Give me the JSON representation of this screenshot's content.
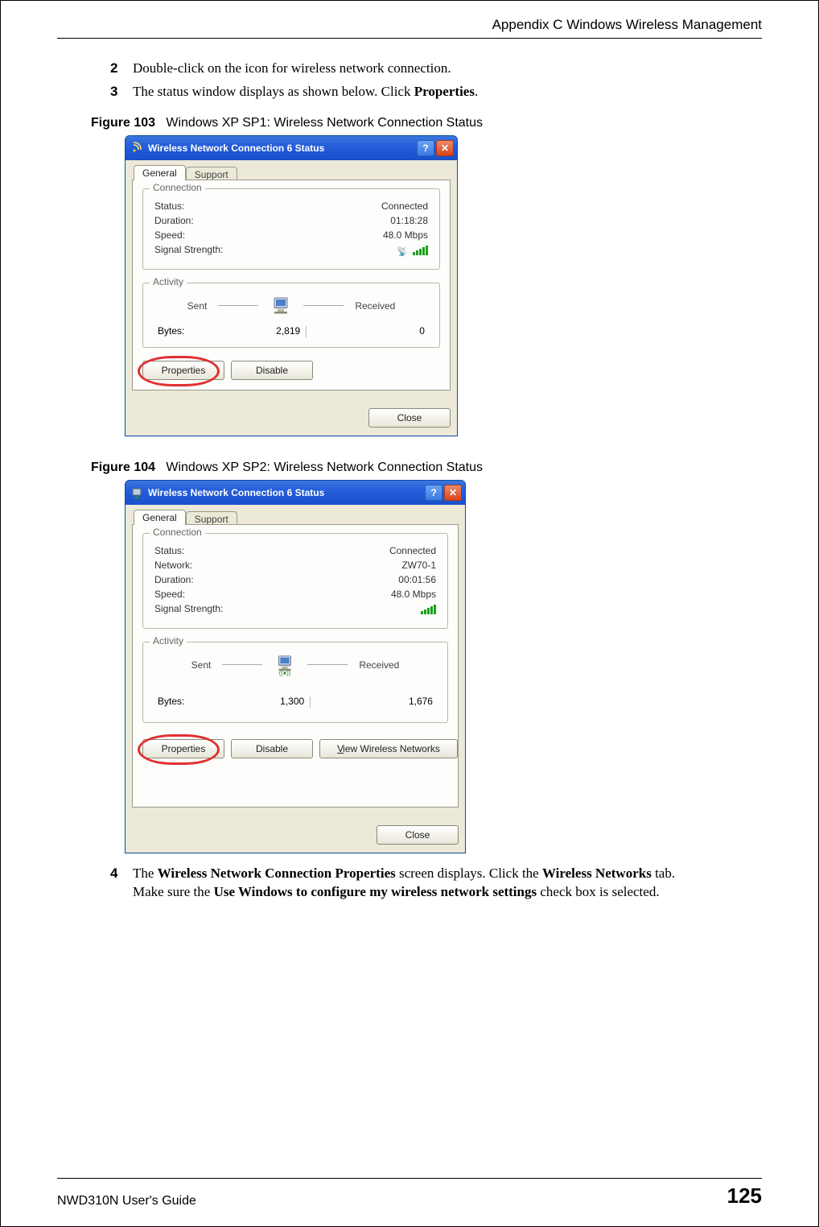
{
  "page": {
    "header": "Appendix C Windows Wireless Management",
    "footer_left": "NWD310N User's Guide",
    "footer_page": "125"
  },
  "steps": {
    "s2num": "2",
    "s2": "Double-click on the icon for wireless network connection.",
    "s3num": "3",
    "s3a": "The status window displays as shown below. Click ",
    "s3b": "Properties",
    "s3c": ".",
    "s4num": "4",
    "s4a": "The ",
    "s4b": "Wireless Network Connection Properties",
    "s4c": " screen displays. Click the ",
    "s4d": "Wireless Networks",
    "s4e": " tab.",
    "s4f": "Make sure the ",
    "s4g": "Use Windows to configure my wireless network settings",
    "s4h": " check box is selected."
  },
  "fig103": {
    "label": "Figure 103",
    "caption": "Windows XP SP1: Wireless Network Connection Status",
    "title": "Wireless Network Connection 6 Status",
    "tab_general": "General",
    "tab_support": "Support",
    "grp_connection": "Connection",
    "k_status": "Status:",
    "v_status": "Connected",
    "k_duration": "Duration:",
    "v_duration": "01:18:28",
    "k_speed": "Speed:",
    "v_speed": "48.0 Mbps",
    "k_signal": "Signal Strength:",
    "grp_activity": "Activity",
    "act_sent": "Sent",
    "act_received": "Received",
    "k_bytes": "Bytes:",
    "v_sent": "2,819",
    "v_recv": "0",
    "btn_properties": "Properties",
    "btn_disable": "Disable",
    "btn_close": "Close"
  },
  "fig104": {
    "label": "Figure 104",
    "caption": "Windows XP SP2: Wireless Network Connection Status",
    "title": "Wireless Network Connection 6 Status",
    "tab_general": "General",
    "tab_support": "Support",
    "grp_connection": "Connection",
    "k_status": "Status:",
    "v_status": "Connected",
    "k_network": "Network:",
    "v_network": "ZW70-1",
    "k_duration": "Duration:",
    "v_duration": "00:01:56",
    "k_speed": "Speed:",
    "v_speed": "48.0 Mbps",
    "k_signal": "Signal Strength:",
    "grp_activity": "Activity",
    "act_sent": "Sent",
    "act_received": "Received",
    "k_bytes": "Bytes:",
    "v_sent": "1,300",
    "v_recv": "1,676",
    "btn_properties": "Properties",
    "btn_disable": "Disable",
    "btn_view": "View Wireless Networks",
    "btn_close": "Close"
  }
}
